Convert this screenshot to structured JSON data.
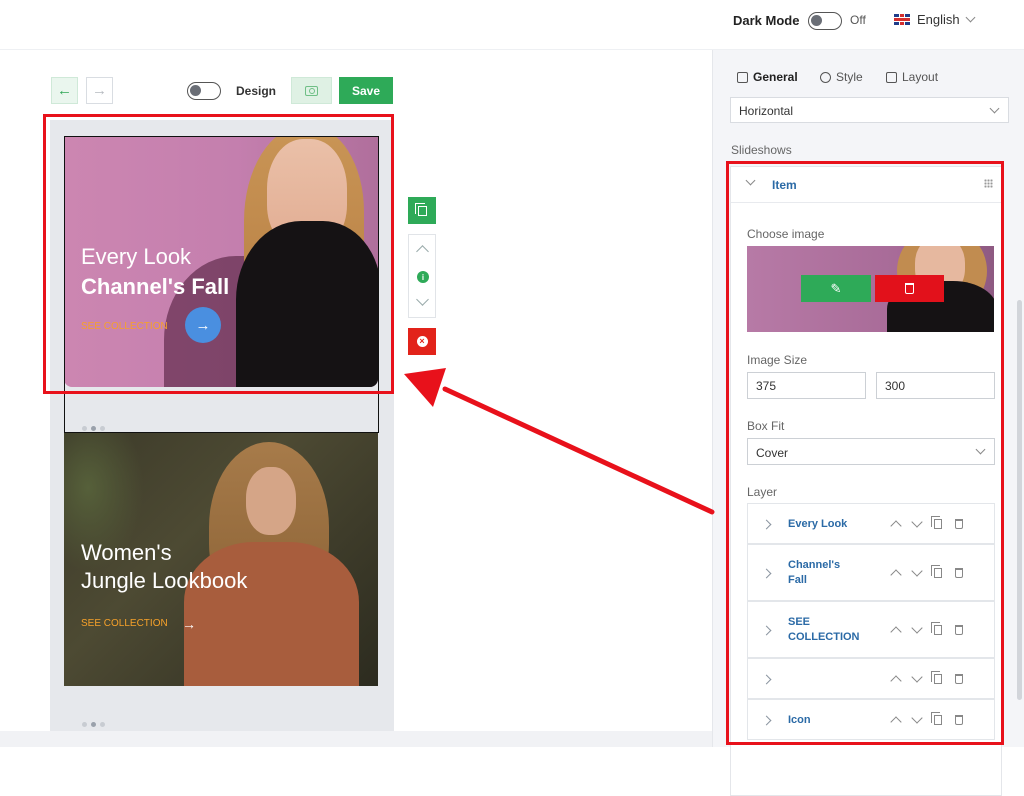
{
  "header": {
    "dark_mode_label": "Dark Mode",
    "dark_mode_state": "Off",
    "language": "English",
    "language_flag": "uk-flag-icon"
  },
  "toolbar": {
    "back_icon": "arrow-left-icon",
    "forward_icon": "arrow-right-icon",
    "design_label": "Design",
    "camera_icon": "camera-icon",
    "save_label": "Save"
  },
  "slides": [
    {
      "line1": "Every Look",
      "line2": "Channel's Fall",
      "cta": "SEE COLLECTION",
      "cta_icon": "arrow-right-icon"
    },
    {
      "line1": "Women's",
      "line2": "Jungle Lookbook",
      "cta": "SEE COLLECTION",
      "cta_icon": "arrow-right-icon"
    }
  ],
  "side_tools": {
    "duplicate_icon": "copy-icon",
    "up_icon": "chevron-up-icon",
    "info_icon": "info-icon",
    "info_text": "i",
    "down_icon": "chevron-down-icon",
    "remove_icon": "close-circle-icon",
    "remove_text": "×"
  },
  "panel": {
    "tabs": [
      {
        "label": "General",
        "icon": "cube-icon",
        "active": true
      },
      {
        "label": "Style",
        "icon": "scissors-icon",
        "active": false
      },
      {
        "label": "Layout",
        "icon": "layout-icon",
        "active": false
      }
    ],
    "direction_value": "Horizontal",
    "slideshows_label": "Slideshows",
    "item": {
      "title": "Item",
      "choose_image_label": "Choose image",
      "edit_icon": "pencil-icon",
      "edit_glyph": "✎",
      "delete_icon": "trash-icon",
      "image_size_label": "Image Size",
      "width": "375",
      "height": "300",
      "box_fit_label": "Box Fit",
      "box_fit_value": "Cover",
      "layer_label": "Layer",
      "layers": [
        {
          "name": "Every Look"
        },
        {
          "name": "Channel's Fall"
        },
        {
          "name": "SEE COLLECTION"
        },
        {
          "name": ""
        },
        {
          "name": "Icon"
        }
      ]
    }
  },
  "colors": {
    "accent_green": "#2eaa58",
    "danger_red": "#e2111b",
    "annotation_red": "#e8111b",
    "link_blue": "#2b6aa6",
    "cta_orange": "#f6a12a"
  }
}
